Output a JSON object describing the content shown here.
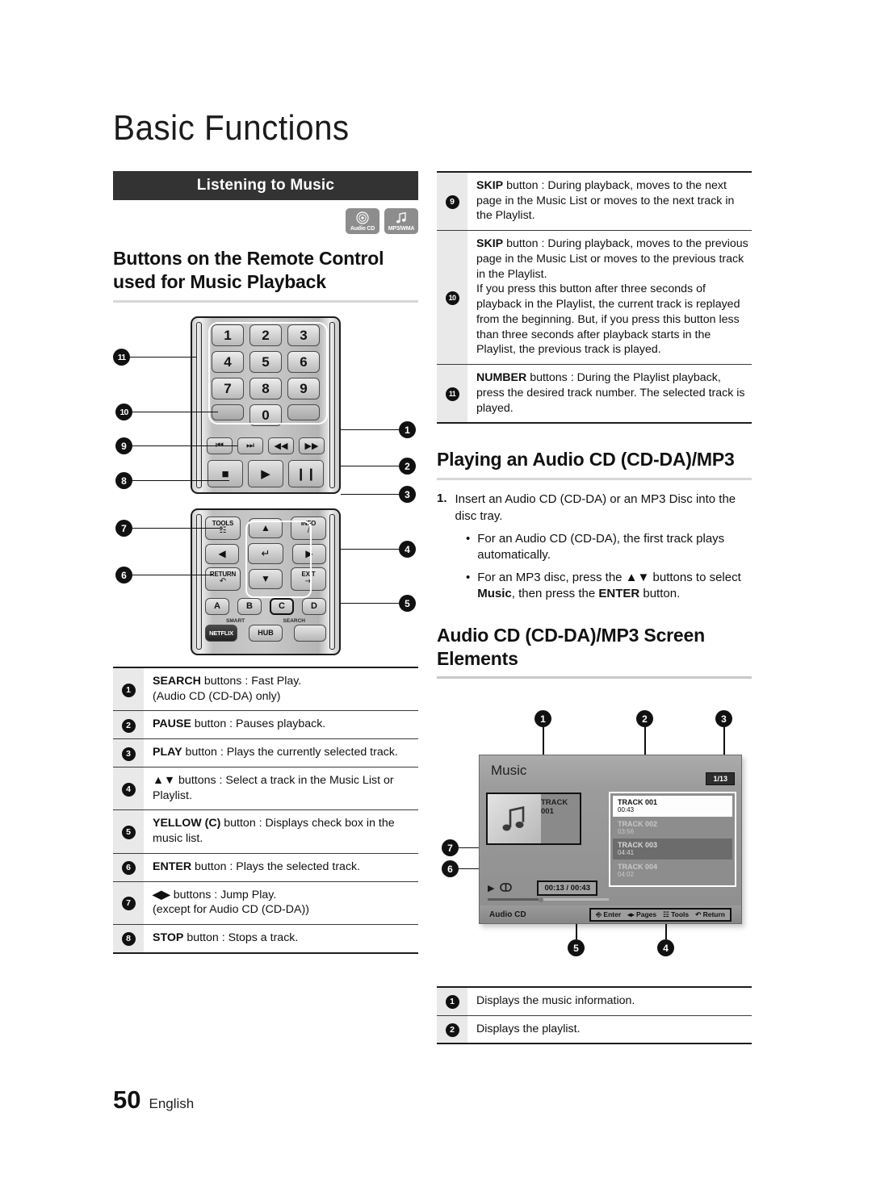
{
  "page": {
    "chapter_title": "Basic Functions",
    "page_number": "50",
    "language": "English"
  },
  "section": {
    "bar_label": "Listening to Music",
    "badges": [
      {
        "icon": "audio-cd-disc-icon",
        "caption": "Audio CD"
      },
      {
        "icon": "music-note-icon",
        "caption": "MP3/WMA"
      }
    ],
    "heading": "Buttons on the Remote Control used for Music Playback"
  },
  "remote": {
    "number_keys": [
      "1",
      "2",
      "3",
      "4",
      "5",
      "6",
      "7",
      "8",
      "9",
      "0"
    ],
    "transport": {
      "skip_prev": "⏮",
      "skip_next": "⏭",
      "rew": "◀◀",
      "ff": "▶▶",
      "stop": "■",
      "play": "▶",
      "pause": "❙❙"
    },
    "pad": {
      "tools": "TOOLS",
      "info": "INFO",
      "up": "▲",
      "down": "▼",
      "left": "◀",
      "right": "▶",
      "enter": "↵",
      "return": "RETURN",
      "exit": "EXIT",
      "color_a": "A",
      "color_b": "B",
      "color_c": "C",
      "color_d": "D",
      "smart": "SMART",
      "search": "SEARCH",
      "netflix": "NETFLIX",
      "hub": "HUB"
    },
    "callouts_left": [
      "11",
      "10",
      "9",
      "8",
      "7",
      "6"
    ],
    "callouts_right": [
      "1",
      "2",
      "3",
      "4",
      "5"
    ]
  },
  "legend_left": [
    {
      "num": "1",
      "bold": "SEARCH",
      "rest": " buttons : Fast Play.",
      "line2": "(Audio CD (CD-DA) only)"
    },
    {
      "num": "2",
      "bold": "PAUSE",
      "rest": " button : Pauses playback.",
      "line2": ""
    },
    {
      "num": "3",
      "bold": "PLAY",
      "rest": " button : Plays the currently selected track.",
      "line2": ""
    },
    {
      "num": "4",
      "bold": "▲▼",
      "rest": " buttons : Select a track in the Music List or Playlist.",
      "line2": ""
    },
    {
      "num": "5",
      "bold": "YELLOW (C)",
      "rest": " button : Displays check box in the music list.",
      "line2": ""
    },
    {
      "num": "6",
      "bold": "ENTER",
      "rest": " button : Plays the selected track.",
      "line2": ""
    },
    {
      "num": "7",
      "bold": "◀▶",
      "rest": " buttons : Jump Play.",
      "line2": "(except for Audio CD (CD-DA))"
    },
    {
      "num": "8",
      "bold": "STOP",
      "rest": " button : Stops a track.",
      "line2": ""
    }
  ],
  "legend_right": [
    {
      "num": "9",
      "bold": "SKIP",
      "rest": " button : During playback, moves to the next page in the Music List or moves to the next track in the Playlist."
    },
    {
      "num": "10",
      "bold": "SKIP",
      "rest": " button : During playback, moves to the previous page in the Music List or moves to the previous track in the Playlist.\nIf you press this button after three seconds of playback in the Playlist, the current track is replayed from the beginning. But, if you press this button less than three seconds after playback starts in the Playlist, the previous track is played."
    },
    {
      "num": "11",
      "bold": "NUMBER",
      "rest": " buttons : During the Playlist playback, press the desired track number. The selected track is played."
    }
  ],
  "playing_section": {
    "heading": "Playing an Audio CD (CD-DA)/MP3",
    "step_number": "1.",
    "step_text": "Insert an Audio CD (CD-DA) or an MP3 Disc into the disc tray.",
    "bullets": [
      {
        "pre": "For an Audio CD (CD-DA), the first track plays automatically.",
        "bold1": "",
        "mid": "",
        "bold2": "",
        "post": ""
      },
      {
        "pre": "For an MP3 disc, press the ▲▼ buttons to select ",
        "bold1": "Music",
        "mid": ", then press the ",
        "bold2": "ENTER",
        "post": " button."
      }
    ]
  },
  "screen_elements": {
    "heading": "Audio CD (CD-DA)/MP3 Screen Elements",
    "callouts_top": [
      "1",
      "2",
      "3"
    ],
    "callouts_left": [
      "7",
      "6"
    ],
    "callouts_bottom": [
      "5",
      "4"
    ]
  },
  "tv_screen": {
    "title": "Music",
    "page_indicator": "1/13",
    "now_playing_label": "TRACK 001",
    "art_icon": "music-note-icon",
    "play_icon": "▶",
    "repeat_icon": "repeat-icon",
    "time": "00:13 / 00:43",
    "source": "Audio CD",
    "hints": [
      {
        "icon": "enter-icon",
        "label": "Enter"
      },
      {
        "icon": "left-right-icon",
        "label": "Pages"
      },
      {
        "icon": "tools-icon",
        "label": "Tools"
      },
      {
        "icon": "return-icon",
        "label": "Return"
      }
    ],
    "playlist": [
      {
        "title": "TRACK 001",
        "duration": "00:43",
        "state": "selected"
      },
      {
        "title": "TRACK 002",
        "duration": "03:56",
        "state": "normal"
      },
      {
        "title": "TRACK 003",
        "duration": "04:41",
        "state": "highlight"
      },
      {
        "title": "TRACK 004",
        "duration": "04:02",
        "state": "normal"
      }
    ]
  },
  "screen_legend": [
    {
      "num": "1",
      "text": "Displays the music information."
    },
    {
      "num": "2",
      "text": "Displays the playlist."
    }
  ]
}
